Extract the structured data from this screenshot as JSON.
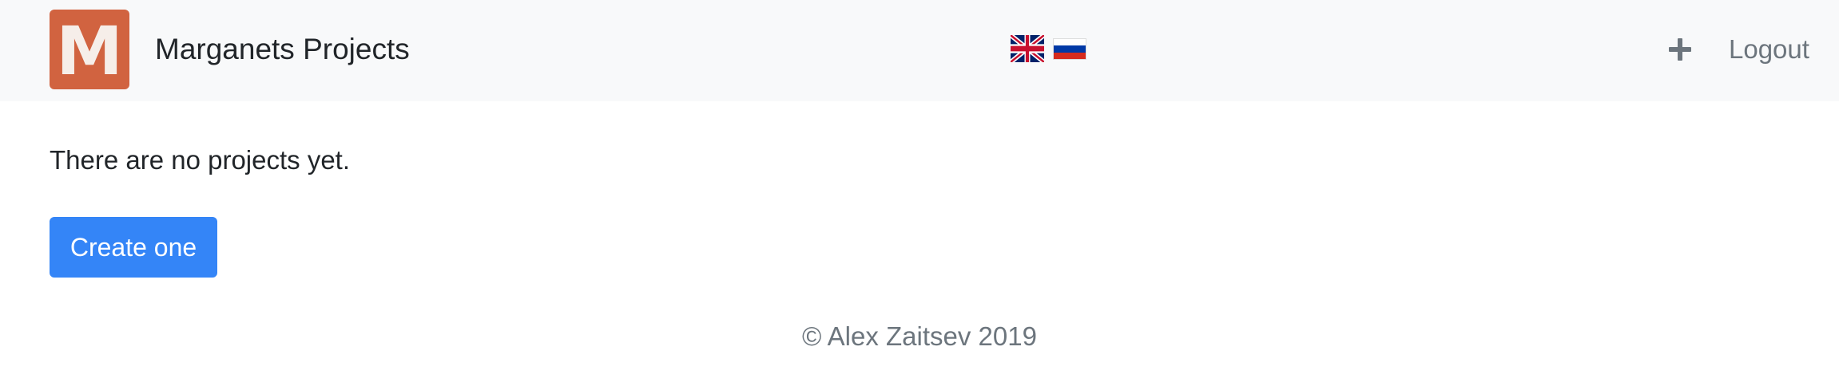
{
  "navbar": {
    "logo_letter": "M",
    "title": "Marganets Projects",
    "languages": [
      {
        "code": "en",
        "icon": "uk-flag-icon"
      },
      {
        "code": "ru",
        "icon": "russia-flag-icon"
      }
    ],
    "add_icon": "plus-icon",
    "logout_label": "Logout"
  },
  "main": {
    "empty_message": "There are no projects yet.",
    "create_button_label": "Create one"
  },
  "footer": {
    "copyright": "© Alex Zaitsev 2019"
  },
  "colors": {
    "navbar_bg": "#f8f9fa",
    "logo_bg": "#d16340",
    "primary": "#3485f7",
    "muted": "#6c757d"
  }
}
